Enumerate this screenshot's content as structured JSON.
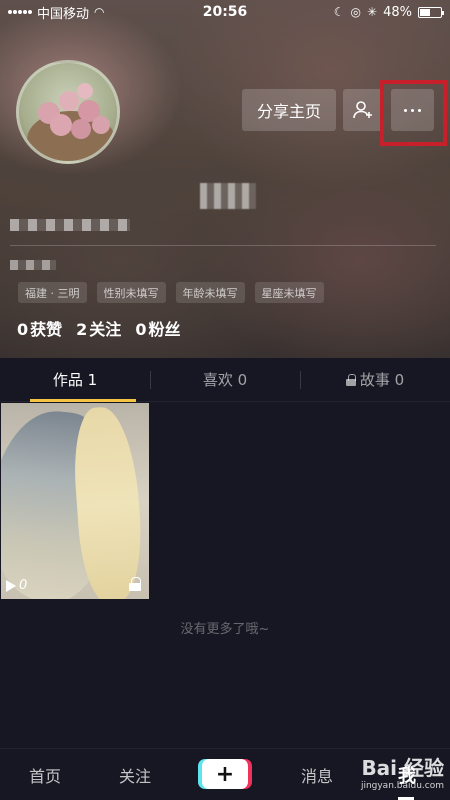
{
  "status_bar": {
    "carrier": "中国移动",
    "time": "20:56",
    "battery_percent": "48%",
    "battery_level": 0.48
  },
  "header": {
    "share_button": "分享主页",
    "add_friend_icon": "person-add-icon",
    "more_icon": "more-dots-icon"
  },
  "tags": [
    "福建 · 三明",
    "性别未填写",
    "年龄未填写",
    "星座未填写"
  ],
  "stats": [
    {
      "num": "0",
      "label": "获赞"
    },
    {
      "num": "2",
      "label": "关注"
    },
    {
      "num": "0",
      "label": "粉丝"
    }
  ],
  "tabs": [
    {
      "label": "作品 1"
    },
    {
      "label": "喜欢 0"
    },
    {
      "label": "故事 0"
    }
  ],
  "posts": [
    {
      "play_count": "0",
      "locked": true
    }
  ],
  "grid": {
    "end_text": "没有更多了哦~"
  },
  "bottom_nav": {
    "home": "首页",
    "follow": "关注",
    "create": "+",
    "messages": "消息",
    "me": "我"
  },
  "watermark": {
    "main": "Bai 经验",
    "sub": "jingyan.baidu.com"
  },
  "colors": {
    "highlight_box": "#c8202a",
    "tab_indicator": "#f5c443",
    "page_background": "#161722"
  }
}
